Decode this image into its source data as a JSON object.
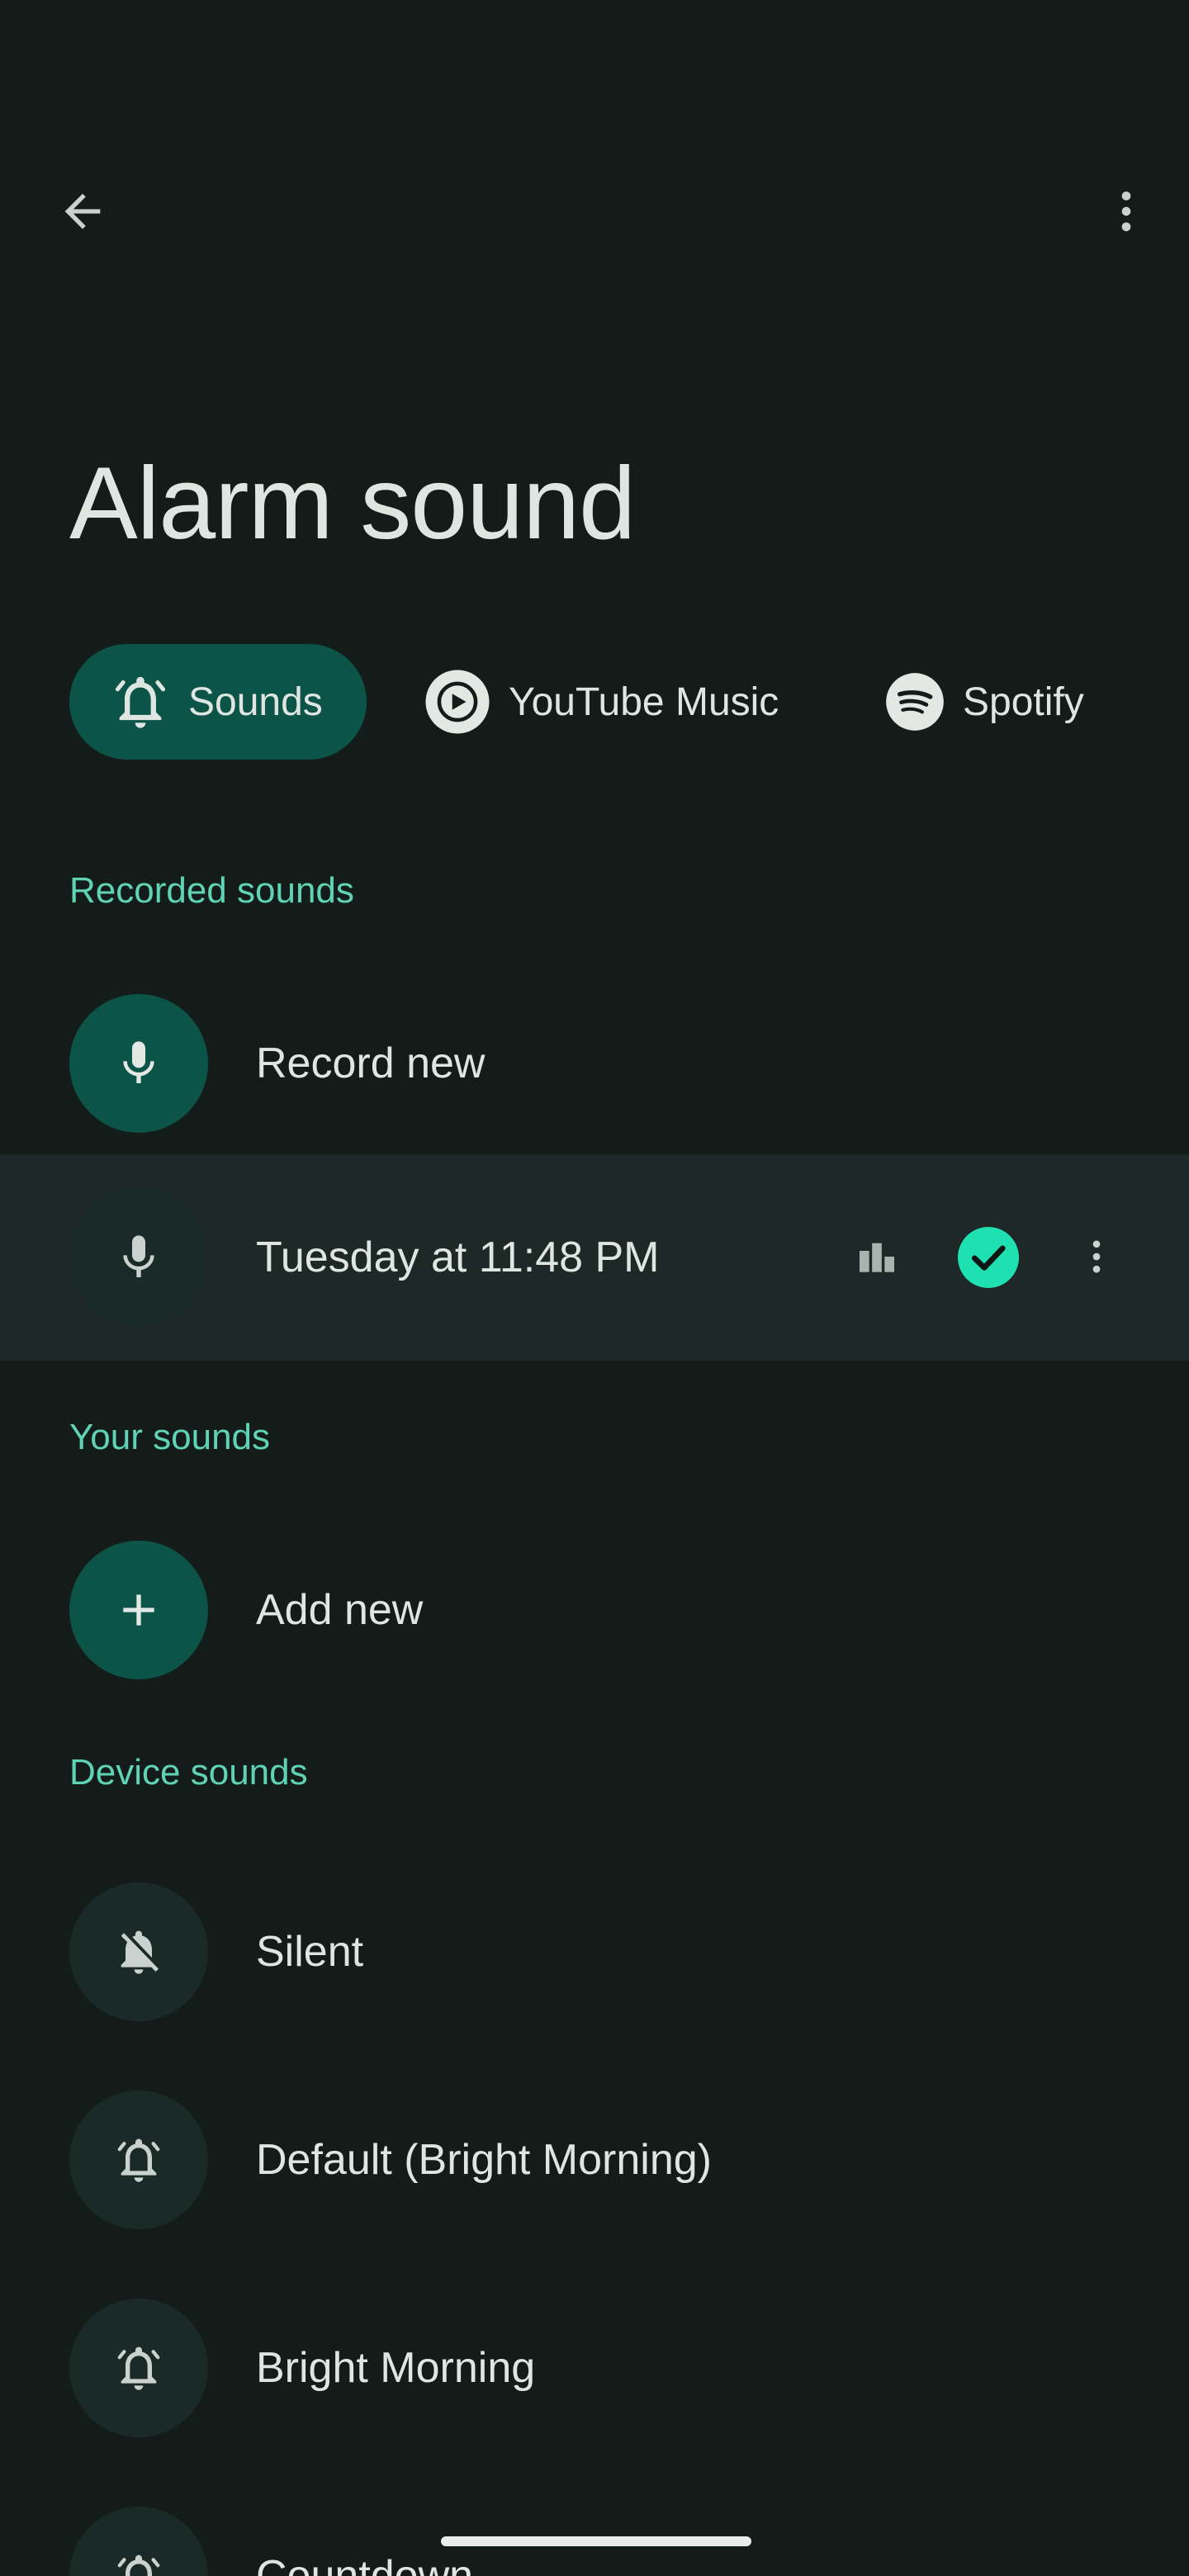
{
  "title": "Alarm sound",
  "tabs": [
    {
      "label": "Sounds",
      "icon": "alarm-bell-icon",
      "selected": true
    },
    {
      "label": "YouTube Music",
      "icon": "youtube-music-icon",
      "selected": false
    },
    {
      "label": "Spotify",
      "icon": "spotify-icon",
      "selected": false
    }
  ],
  "sections": {
    "recorded": {
      "header": "Recorded sounds",
      "record_new": "Record new",
      "items": [
        {
          "label": "Tuesday at 11:48 PM",
          "selected": true
        }
      ]
    },
    "yours": {
      "header": "Your sounds",
      "add_new": "Add new"
    },
    "device": {
      "header": "Device sounds",
      "items": [
        {
          "label": "Silent",
          "icon": "bell-off-icon"
        },
        {
          "label": "Default (Bright Morning)",
          "icon": "alarm-bell-icon"
        },
        {
          "label": "Bright Morning",
          "icon": "alarm-bell-icon"
        },
        {
          "label": "Countdown",
          "icon": "alarm-bell-icon"
        }
      ]
    }
  },
  "colors": {
    "background": "#141c1a",
    "accent_container": "#0d5448",
    "accent_text": "#5fd3b3",
    "check": "#1ee0b0",
    "selected_row": "#1e2927"
  }
}
